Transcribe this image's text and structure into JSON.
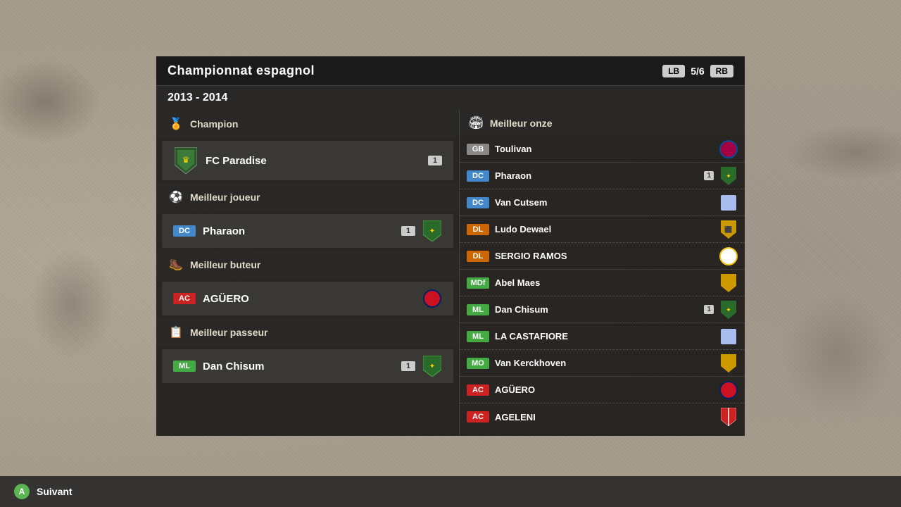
{
  "background": {
    "color": "#a89e8e"
  },
  "panel": {
    "title": "Championnat espagnol",
    "nav_lb": "LB",
    "nav_page": "5/6",
    "nav_rb": "RB",
    "year": "2013 - 2014"
  },
  "champion_section": {
    "title": "Champion",
    "icon": "🏅",
    "player": {
      "name": "FC Paradise",
      "rating": "1",
      "club_icon": "paradise"
    }
  },
  "best_player_section": {
    "title": "Meilleur joueur",
    "icon": "⚽",
    "player": {
      "position": "DC",
      "pos_class": "pos-dc",
      "name": "Pharaon",
      "rating": "1",
      "club": "green-shield"
    }
  },
  "best_scorer_section": {
    "title": "Meilleur buteur",
    "icon": "🥾",
    "player": {
      "position": "AC",
      "pos_class": "pos-ac",
      "name": "AGÜERO",
      "club": "atletico"
    }
  },
  "best_passer_section": {
    "title": "Meilleur passeur",
    "icon": "📋",
    "player": {
      "position": "ML",
      "pos_class": "pos-ml",
      "name": "Dan Chisum",
      "rating": "1",
      "club": "green-shield"
    }
  },
  "best_eleven_section": {
    "title": "Meilleur onze",
    "icon": "🏟",
    "players": [
      {
        "position": "GB",
        "pos_class": "pos-gb",
        "name": "Toulivan",
        "club": "barca",
        "rating": null
      },
      {
        "position": "DC",
        "pos_class": "pos-dc",
        "name": "Pharaon",
        "club": "green-shield",
        "rating": "1"
      },
      {
        "position": "DC",
        "pos_class": "pos-dc",
        "name": "Van Cutsem",
        "club": "blue-light",
        "rating": null
      },
      {
        "position": "DL",
        "pos_class": "pos-dl",
        "name": "Ludo Dewael",
        "club": "yellow-shield",
        "rating": null
      },
      {
        "position": "DL",
        "pos_class": "pos-dl",
        "name": "SERGIO RAMOS",
        "club": "real",
        "rating": null
      },
      {
        "position": "MDf",
        "pos_class": "pos-mdf",
        "name": "Abel Maes",
        "club": "yellow-shield",
        "rating": null
      },
      {
        "position": "ML",
        "pos_class": "pos-ml",
        "name": "Dan Chisum",
        "club": "green-shield",
        "rating": "1"
      },
      {
        "position": "ML",
        "pos_class": "pos-ml",
        "name": "LA CASTAFIORE",
        "club": "blue-light",
        "rating": null
      },
      {
        "position": "MO",
        "pos_class": "pos-mo",
        "name": "Van Kerckhoven",
        "club": "yellow-shield",
        "rating": null
      },
      {
        "position": "AC",
        "pos_class": "pos-ac",
        "name": "AGÜERO",
        "club": "atletico",
        "rating": null
      },
      {
        "position": "AC",
        "pos_class": "pos-ac",
        "name": "AGELENI",
        "club": "red-white",
        "rating": null
      }
    ]
  },
  "bottom_bar": {
    "button_icon": "A",
    "button_label": "Suivant"
  }
}
